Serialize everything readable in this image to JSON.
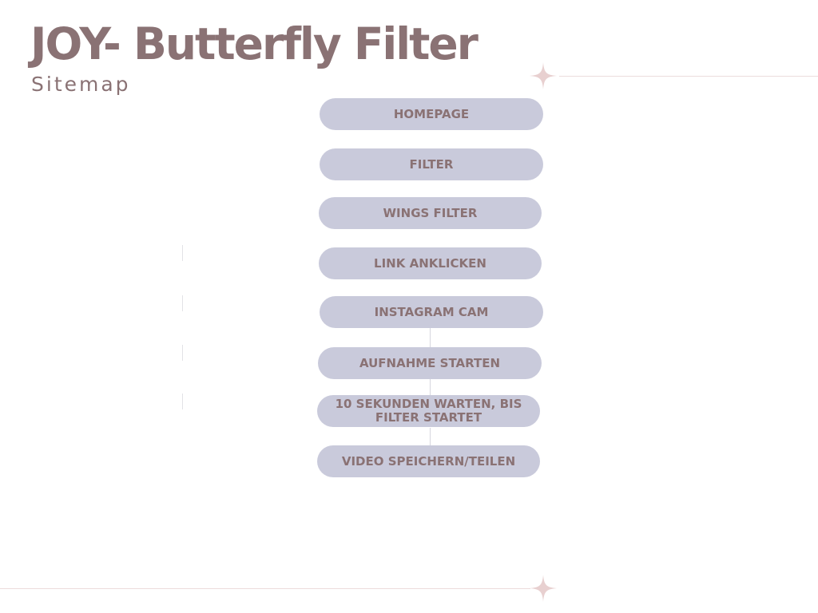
{
  "header": {
    "title": "JOY- Butterfly Filter",
    "subtitle": "Sitemap"
  },
  "decor": {
    "sparkle_icon": "four-point-star",
    "sparkle_color": "#e8d0d0",
    "line_color": "#ecdcdc"
  },
  "sitemap": {
    "node_color": "#c9cadb",
    "text_color": "#8a7274",
    "nodes": [
      {
        "label": "HOMEPAGE"
      },
      {
        "label": "FILTER"
      },
      {
        "label": "WINGS FILTER"
      },
      {
        "label": "LINK ANKLICKEN"
      },
      {
        "label": "INSTAGRAM CAM"
      },
      {
        "label": "AUFNAHME STARTEN"
      },
      {
        "label": "10 SEKUNDEN WARTEN, BIS\nFILTER STARTET"
      },
      {
        "label": "VIDEO SPEICHERN/TEILEN"
      }
    ]
  }
}
